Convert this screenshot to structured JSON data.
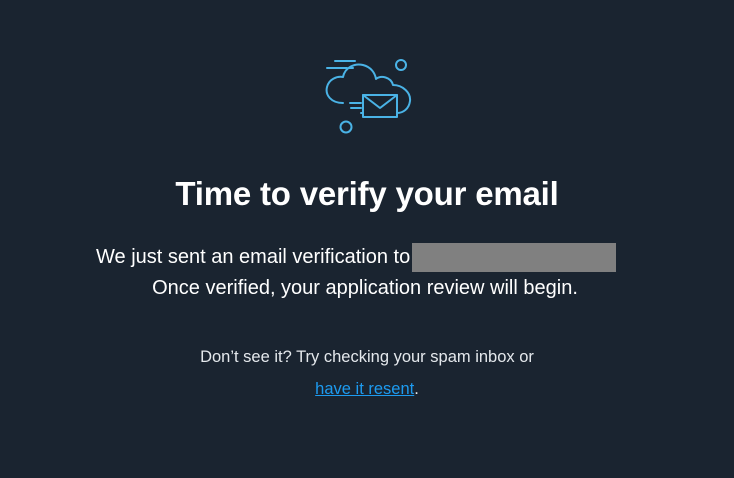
{
  "icon": "cloud-mail-icon",
  "colors": {
    "background": "#1a2430",
    "icon": "#4ab3e6",
    "link": "#1d9bf0",
    "redaction": "#808080"
  },
  "title": "Time to verify your email",
  "message": {
    "line1": "We just sent an email verification to",
    "line2": "Once verified, your application review will begin."
  },
  "help": {
    "text": "Don’t see it? Try checking your spam inbox or",
    "link_label": "have it resent",
    "suffix": "."
  }
}
